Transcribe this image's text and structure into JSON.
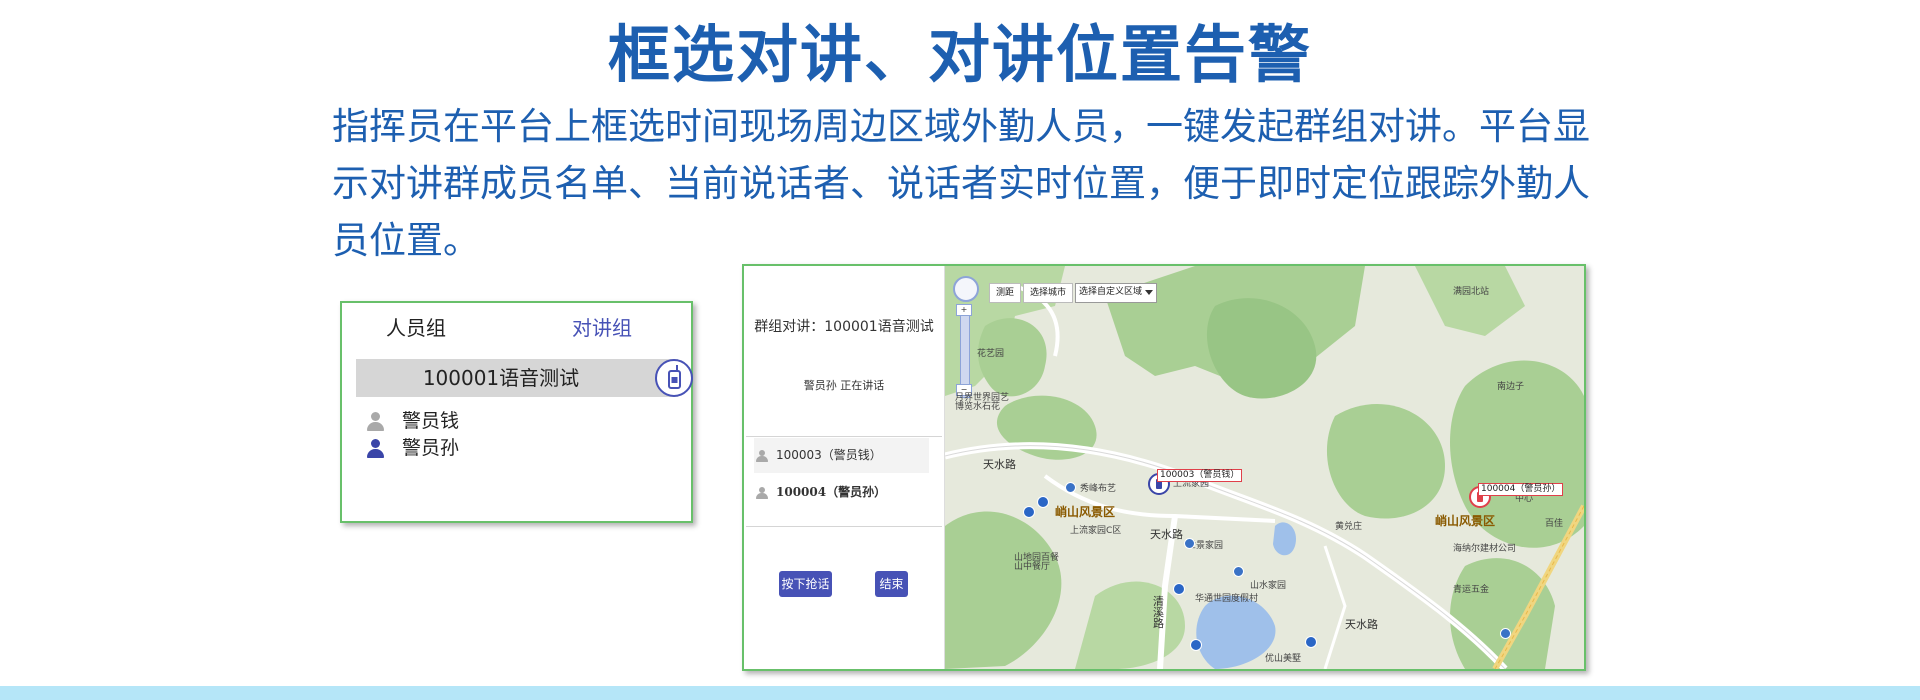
{
  "page": {
    "title": "框选对讲、对讲位置告警",
    "description": "指挥员在平台上框选时间现场周边区域外勤人员，一键发起群组对讲。平台显示对讲群成员名单、当前说话者、说话者实时位置，便于即时定位跟踪外勤人员位置。"
  },
  "left_panel": {
    "tabs": [
      "人员组",
      "对讲组"
    ],
    "group_name": "100001语音测试",
    "members": [
      {
        "name": "警员钱",
        "icon": "person-gray-icon"
      },
      {
        "name": "警员孙",
        "icon": "person-blue-icon"
      }
    ]
  },
  "right_panel": {
    "group_title": "群组对讲：100001语音测试",
    "speaking": "警员孙 正在讲话",
    "members": [
      {
        "label": "100003（警员钱）",
        "bold": false
      },
      {
        "label": "100004（警员孙）",
        "bold": true
      }
    ],
    "buttons": {
      "talk": "按下抢话",
      "end": "结束"
    }
  },
  "map": {
    "toolbar": {
      "measure": "测距",
      "city": "选择城市",
      "region": "选择自定义区域"
    },
    "zoom_in": "+",
    "zoom_out": "−",
    "labels": {
      "area1": "峭山风景区",
      "area2": "峭山风景区",
      "road1": "天水路",
      "road2": "天水路",
      "road3": "清溪路",
      "road4": "天水路",
      "poi1": "秀峰布艺",
      "poi2": "上流家园",
      "poi3": "上流家园C区",
      "poi4": "世景家园",
      "poi5": "山水家园",
      "poi6": "华通世园度假村",
      "poi7": "海纳尔建材公司",
      "poi8": "青运五金",
      "poi9": "山地园百餐山中餐厅",
      "poi10": "花艺园",
      "poi11": "南边子",
      "poi12": "满园北站",
      "poi13": "中心",
      "poi14": "优山美墅",
      "poi15": "黄兑庄",
      "poi16": "百佳",
      "poi17": "月界世界园艺博览水石花"
    },
    "markers": [
      {
        "label": "100003（警员钱）",
        "icon": "walkie-talkie-blue-icon"
      },
      {
        "label": "100004（警员孙）",
        "icon": "walkie-talkie-red-icon"
      }
    ],
    "colors": {
      "land": "#e6e9dc",
      "green": "#a9cf94",
      "water": "#9fc0ea",
      "road": "#ffffff"
    }
  },
  "colors": {
    "title": "#1d5fb0",
    "accent": "#4752b6",
    "panel_border": "#68c06a",
    "footer": "#b5e6f8"
  }
}
